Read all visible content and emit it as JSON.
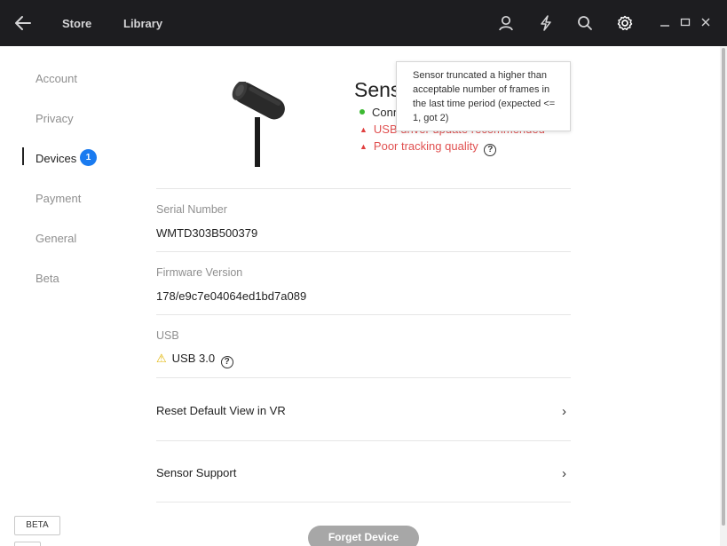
{
  "topbar": {
    "store": "Store",
    "library": "Library"
  },
  "icons": {
    "back": "back-arrow-icon",
    "user": "user-icon",
    "notifications": "lightning-icon",
    "search": "search-icon",
    "settings": "gear-icon"
  },
  "sidebar": {
    "items": [
      {
        "label": "Account"
      },
      {
        "label": "Privacy"
      },
      {
        "label": "Devices",
        "badge": "1"
      },
      {
        "label": "Payment"
      },
      {
        "label": "General"
      },
      {
        "label": "Beta"
      }
    ],
    "beta_button": "BETA"
  },
  "device": {
    "title": "Sens",
    "status_connected": "Conn",
    "status_usb_driver": "USB driver update recommended",
    "status_tracking": "Poor tracking quality",
    "help_glyph": "?"
  },
  "tooltip": {
    "text": "Sensor truncated a higher than acceptable number of frames in the last time period (expected <= 1, got 2)"
  },
  "details": {
    "serial_label": "Serial Number",
    "serial_value": "WMTD303B500379",
    "firmware_label": "Firmware Version",
    "firmware_value": "178/e9c7e04064ed1bd7a089",
    "usb_label": "USB",
    "usb_value": "USB 3.0"
  },
  "actions": {
    "reset_view": "Reset Default View in VR",
    "sensor_support": "Sensor Support",
    "forget_device": "Forget Device"
  },
  "colors": {
    "topbar_bg": "#1d1d20",
    "badge_blue": "#1a7bf0",
    "ok_green": "#3cb932",
    "warn_red": "#e05050",
    "warn_yellow": "#e1b400"
  }
}
